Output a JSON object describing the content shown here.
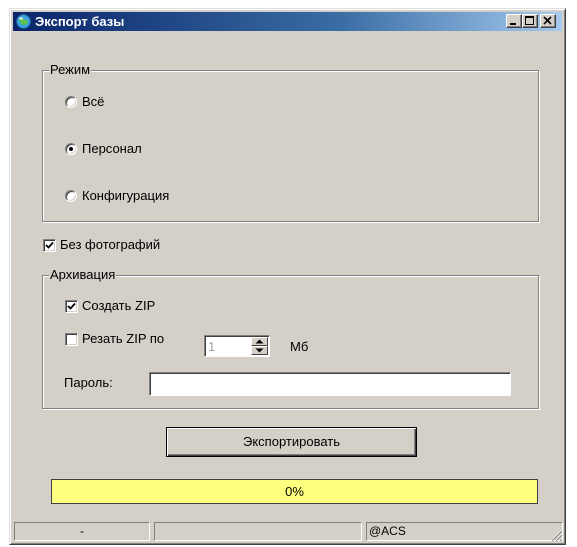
{
  "window": {
    "title": "Экспорт базы",
    "icon": "app-globe-icon",
    "controls": [
      "minimize-icon",
      "maximize-icon",
      "close-icon"
    ]
  },
  "mode_group": {
    "legend": "Режим",
    "options": [
      {
        "label": "Всё",
        "selected": false
      },
      {
        "label": "Персонал",
        "selected": true
      },
      {
        "label": "Конфигурация",
        "selected": false
      }
    ]
  },
  "no_photos": {
    "label": "Без фотографий",
    "checked": true
  },
  "archive_group": {
    "legend": "Архивация",
    "create_zip": {
      "label": "Создать ZIP",
      "checked": true
    },
    "split_zip": {
      "label": "Резать ZIP по",
      "checked": false,
      "value": "1",
      "unit": "Мб"
    },
    "password": {
      "label": "Пароль:",
      "value": ""
    }
  },
  "export_button": {
    "label": "Экспортировать"
  },
  "progress": {
    "text": "0%",
    "percent": 0,
    "color": "#ffff80"
  },
  "statusbar": {
    "panels": [
      "-",
      "",
      "@ACS"
    ]
  },
  "colors": {
    "face": "#d4d0c8",
    "title_start": "#0a246a",
    "title_end": "#a6caf0",
    "progress_bar": "#ffff80"
  }
}
